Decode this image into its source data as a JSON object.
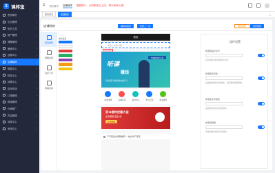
{
  "app": {
    "logo_mark": "S",
    "logo_text": "课邦宝"
  },
  "sidebar": {
    "items": [
      {
        "label": "首页概况",
        "active": false
      },
      {
        "label": "企业管理",
        "active": false
      },
      {
        "label": "知识工具",
        "active": false
      },
      {
        "label": "用户管理",
        "active": false
      },
      {
        "label": "课程管理",
        "active": false
      },
      {
        "label": "营销中心",
        "active": false
      },
      {
        "label": "运营中心",
        "active": false
      },
      {
        "label": "店铺装修",
        "active": true
      },
      {
        "label": "数据中心",
        "active": false
      },
      {
        "label": "财务中心",
        "active": false
      },
      {
        "label": "设置中心",
        "active": false
      },
      {
        "label": "应用市场",
        "active": false
      },
      {
        "label": "订单管理",
        "active": false
      },
      {
        "label": "群组管理",
        "active": false
      },
      {
        "label": "分销推广",
        "active": false
      },
      {
        "label": "内容管理",
        "active": false
      },
      {
        "label": "消息中心",
        "active": false
      },
      {
        "label": "系统中心",
        "active": false
      }
    ]
  },
  "topbar": {
    "menu_icon": "≡",
    "nav": [
      "首页概况",
      "店铺装修"
    ],
    "notice": "温馨提示：以前新版已上线，请以新版为准！",
    "icons": [
      "bell-icon",
      "help-icon",
      "fullscreen-icon"
    ]
  },
  "tabs": {
    "items": [
      "首页概况",
      "店铺装修"
    ],
    "close_icon": "×"
  },
  "panel": {
    "title": "店铺装修",
    "btn_save": "保存并发布",
    "btn_reset": "还原上一次",
    "btn_preview": "预览装修",
    "btn_publish": "发布装修"
  },
  "side_tabs": [
    {
      "label": "首页装修",
      "active": true
    },
    {
      "label": "课程内容",
      "active": false
    },
    {
      "label": "自定义页",
      "active": false
    },
    {
      "label": "营销活动",
      "active": false
    }
  ],
  "palette": {
    "label": "颜色设置",
    "colors": [
      "#1677ff",
      "#ffffff",
      "#e23b3b",
      "#27ae60",
      "#8e44ad",
      "#f39c12",
      "#f1c40f"
    ]
  },
  "phone": {
    "header_title": "首页",
    "search_placeholder": "请输入搜索内容",
    "search_icon": "⌕",
    "selected_tag": "搜索组件",
    "banner_line1": "听课",
    "banner_line2": "赚钱",
    "banner_badge": "52课程全新上线",
    "banner_sub": "名师课程 随时随地在线学习",
    "nav": [
      {
        "label": "在线课堂",
        "color": "#1677ff"
      },
      {
        "label": "直播互动",
        "color": "#ff4d4f"
      },
      {
        "label": "会员中心",
        "color": "#13c2c2"
      },
      {
        "label": "学习记录",
        "color": "#1677ff"
      },
      {
        "label": "更多服务",
        "color": "#52c41a"
      }
    ],
    "promo_title": "双11限时优惠大促",
    "promo_sub": "全场课程 低至5折",
    "promo_btn": "立即抢购",
    "list_item": "不可错过的课程推荐 一站式学习专区"
  },
  "settings": {
    "title": "组件设置",
    "blocks": [
      {
        "label": "搜索框提示文字",
        "desc": "显示在搜索框内的提示文字"
      },
      {
        "label": "搜索框背景色",
        "desc": "设置搜索框的背景颜色，适配当前页面风格"
      },
      {
        "label": "搜索框文字颜色",
        "desc": "设置搜索框内文字的颜色"
      },
      {
        "label": "搜索框圆角",
        "desc": "开启后搜索框显示为圆角"
      }
    ]
  }
}
